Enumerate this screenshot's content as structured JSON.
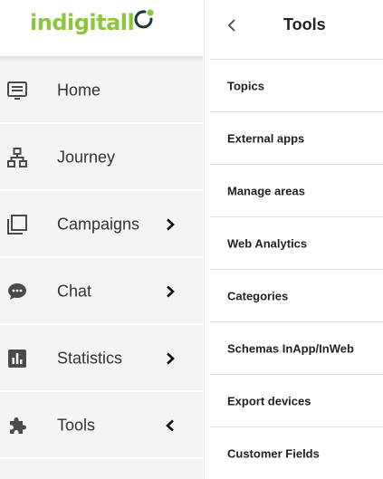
{
  "brand": {
    "name": "indigitall",
    "color": "#8cc63f",
    "dark": "#1b3a3a"
  },
  "sidebar": {
    "items": [
      {
        "label": "Home",
        "icon": "home-screen-icon",
        "chevron": ""
      },
      {
        "label": "Journey",
        "icon": "journey-sitemap-icon",
        "chevron": ""
      },
      {
        "label": "Campaigns",
        "icon": "campaigns-stack-icon",
        "chevron": "›"
      },
      {
        "label": "Chat",
        "icon": "chat-bubble-icon",
        "chevron": "›"
      },
      {
        "label": "Statistics",
        "icon": "statistics-chart-icon",
        "chevron": "›"
      },
      {
        "label": "Tools",
        "icon": "puzzle-icon",
        "chevron": "‹"
      }
    ]
  },
  "panel": {
    "title": "Tools",
    "back_icon": "chevron-left-icon",
    "items": [
      {
        "label": "Topics"
      },
      {
        "label": "External apps"
      },
      {
        "label": "Manage areas"
      },
      {
        "label": "Web Analytics"
      },
      {
        "label": "Categories"
      },
      {
        "label": "Schemas InApp/InWeb"
      },
      {
        "label": "Export devices"
      },
      {
        "label": "Customer Fields"
      }
    ]
  }
}
